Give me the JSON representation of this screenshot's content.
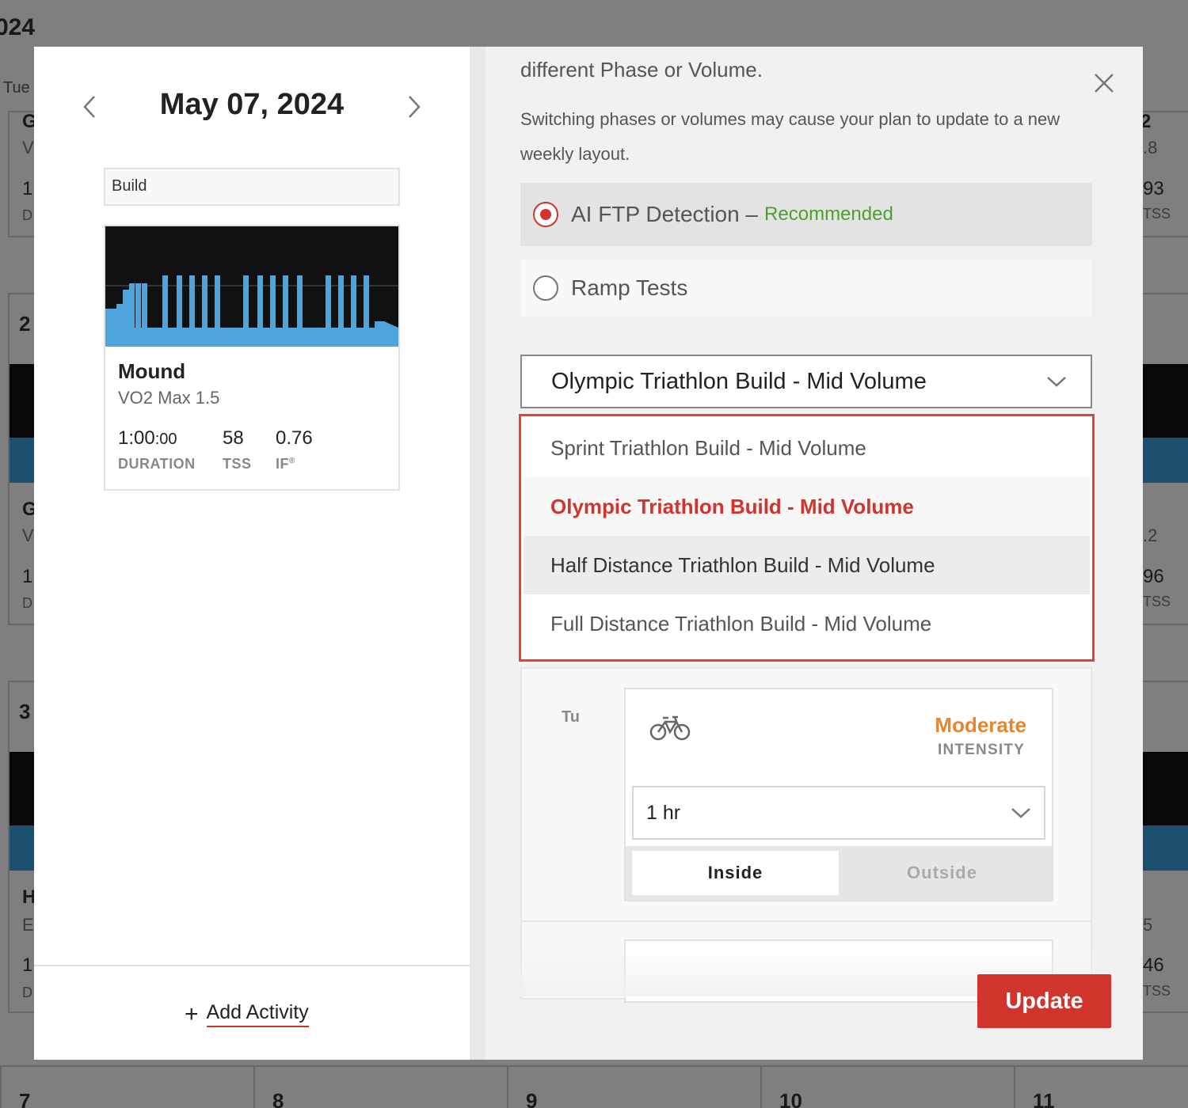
{
  "background": {
    "year_fragment": "024",
    "day_of_week": "Tue",
    "row_numbers": [
      "2",
      "3"
    ],
    "right_fragments": [
      "2",
      ".8",
      "93",
      "TSS",
      ".2",
      "96",
      "TSS",
      "5",
      "46",
      "TSS"
    ],
    "left_fragments": [
      "G",
      "V",
      "1:",
      "D",
      "G",
      "V",
      "1:",
      "D",
      "H",
      "E",
      "1:",
      "D"
    ],
    "bottom_days": [
      "7",
      "8",
      "9",
      "10",
      "11"
    ]
  },
  "left_panel": {
    "date_title": "May 07, 2024",
    "phase_label": "Build",
    "workout": {
      "name": "Mound",
      "subtitle": "VO2 Max 1.5",
      "stats": [
        {
          "value": "1:00",
          "value_suffix": ":00",
          "label": "DURATION"
        },
        {
          "value": "58",
          "label": "TSS"
        },
        {
          "value": "0.76",
          "label": "IF",
          "label_sup": "®"
        }
      ]
    },
    "add_activity_label": "Add Activity"
  },
  "right_panel": {
    "info_line_1": "different Phase or Volume.",
    "info_line_2": "Switching phases or volumes may cause your plan to update to a new weekly layout.",
    "ftp_options": [
      {
        "label": "AI FTP Detection",
        "dash": " –",
        "badge": "Recommended",
        "checked": true
      },
      {
        "label": "Ramp Tests",
        "checked": false
      }
    ],
    "plan_select_value": "Olympic Triathlon Build - Mid Volume",
    "plan_options": [
      {
        "label": "Sprint Triathlon Build - Mid Volume",
        "state": "normal"
      },
      {
        "label": "Olympic Triathlon Build - Mid Volume",
        "state": "selected"
      },
      {
        "label": "Half Distance Triathlon Build - Mid Volume",
        "state": "hovered"
      },
      {
        "label": "Full Distance Triathlon Build - Mid Volume",
        "state": "normal"
      }
    ],
    "day": {
      "label": "Tu",
      "intensity_value": "Moderate",
      "intensity_label": "INTENSITY",
      "duration_value": "1 hr",
      "toggle": {
        "inside": "Inside",
        "outside": "Outside",
        "active": "inside"
      }
    },
    "update_label": "Update"
  },
  "colors": {
    "accent_red": "#d0342c",
    "recommended_green": "#4ba02c",
    "intensity_orange": "#e8862e",
    "chart_blue": "#3aa0dd",
    "dropdown_highlight_border": "#e8422e"
  },
  "icons": {
    "prev": "chevron-left-icon",
    "next": "chevron-right-icon",
    "close": "close-icon",
    "select_arrow": "chevron-down-icon",
    "bike": "bike-icon",
    "add": "plus-icon"
  }
}
